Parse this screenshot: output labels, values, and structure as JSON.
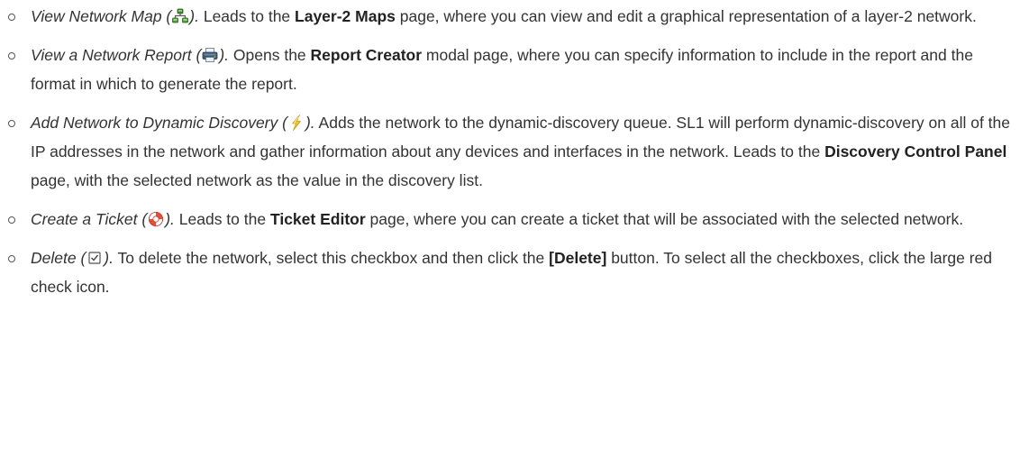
{
  "items": [
    {
      "term": "View Network Map (",
      "icon": "network-map-icon",
      "after_icon": ").",
      "text1": " Leads to the ",
      "bold": "Layer-2 Maps",
      "text2": " page, where you can view and edit a graphical representation of a layer-2 network."
    },
    {
      "term": "View a Network Report (",
      "icon": "printer-icon",
      "after_icon": ").",
      "text1": " Opens the ",
      "bold": "Report Creator",
      "text2": " modal page, where you can specify information to include in the report and the format in which to generate the report."
    },
    {
      "term": "Add Network to Dynamic Discovery (",
      "icon": "lightning-bolt-icon",
      "after_icon": ").",
      "text1": " Adds the network to the dynamic-discovery queue. SL1 will perform dynamic-discovery on all of the IP addresses in the network and gather information about any devices and interfaces in the network. Leads to the ",
      "bold": "Discovery Control Panel",
      "text2": " page, with the selected network as the value in the discovery list."
    },
    {
      "term": "Create a Ticket (",
      "icon": "life-ring-icon",
      "after_icon": ").",
      "text1": " Leads to the ",
      "bold": "Ticket Editor",
      "text2": " page, where you can create a ticket that will be associated with the selected network."
    },
    {
      "term": "Delete (",
      "icon": "checkbox-icon",
      "after_icon": ").",
      "text1": " To delete the network, select this checkbox and then click the ",
      "bold": "[Delete]",
      "text2": " button. To select all the checkboxes, click the large red check icon."
    }
  ]
}
